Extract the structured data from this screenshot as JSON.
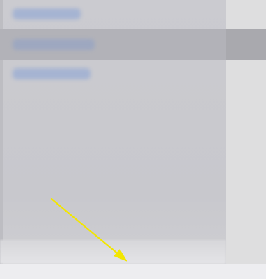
{
  "menu": {
    "items": [
      {
        "label": ""
      },
      {
        "label": ""
      },
      {
        "label": ""
      }
    ],
    "selected_index": 1
  },
  "annotation": {
    "icon": "arrow-pointer-icon",
    "color": "#f2e600"
  },
  "colors": {
    "panel_bg": "#c8c8cd",
    "selected_row": "#b2b2b8",
    "blurred_link_text": "#9fb0d3"
  }
}
